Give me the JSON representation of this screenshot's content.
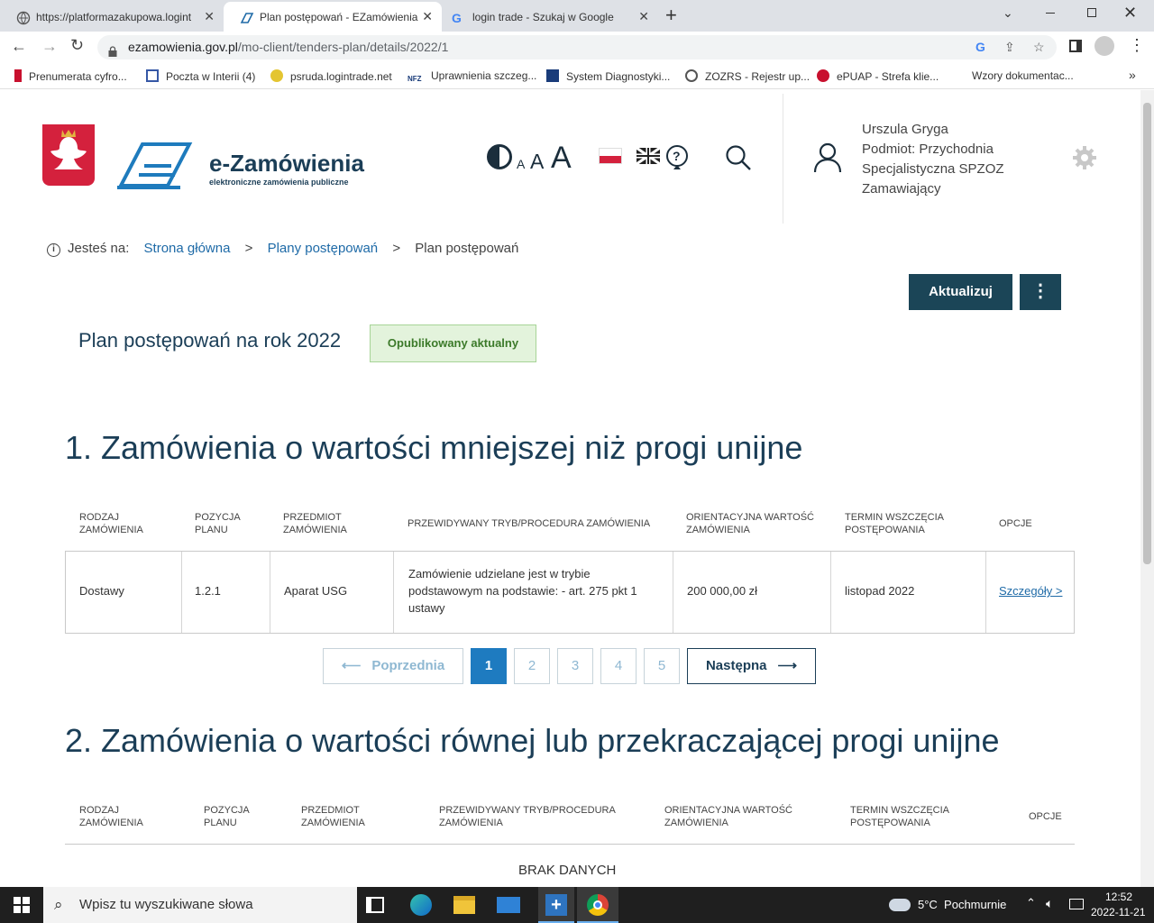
{
  "browser": {
    "tabs": [
      {
        "title": "https://platformazakupowa.logint"
      },
      {
        "title": "Plan postępowań - EZamówienia"
      },
      {
        "title": "login trade - Szukaj w Google"
      }
    ],
    "url_host": "ezamowienia.gov.pl",
    "url_path": "/mo-client/tenders-plan/details/2022/1",
    "bookmarks": [
      "Prenumerata cyfro...",
      "Poczta w Interii (4)",
      "psruda.logintrade.net",
      "Uprawnienia szczeg...",
      "System Diagnostyki...",
      "ZOZRS - Rejestr up...",
      "ePUAP - Strefa klie...",
      "Wzory dokumentac..."
    ]
  },
  "header": {
    "logo_title": "e-Zamówienia",
    "logo_subtitle": "elektroniczne zamówienia publiczne",
    "font_sizes": [
      "A",
      "A",
      "A"
    ],
    "user_name": "Urszula Gryga",
    "user_entity": "Podmiot: Przychodnia Specjalistyczna SPZOZ",
    "user_role": "Zamawiający"
  },
  "breadcrumb": {
    "prefix": "Jesteś na:",
    "items": [
      "Strona główna",
      "Plany postępowań",
      "Plan postępowań"
    ],
    "separator": ">"
  },
  "actions": {
    "update": "Aktualizuj"
  },
  "plan": {
    "title": "Plan postępowań na rok 2022",
    "status": "Opublikowany aktualny"
  },
  "section1": {
    "title": "1. Zamówienia o wartości mniejszej niż progi unijne",
    "headers": [
      "RODZAJ ZAMÓWIENIA",
      "POZYCJA PLANU",
      "PRZEDMIOT ZAMÓWIENIA",
      "PRZEWIDYWANY TRYB/PROCEDURA ZAMÓWIENIA",
      "ORIENTACYJNA WARTOŚĆ ZAMÓWIENIA",
      "TERMIN WSZCZĘCIA POSTĘPOWANIA",
      "OPCJE"
    ],
    "row": {
      "type": "Dostawy",
      "position": "1.2.1",
      "subject": "Aparat USG",
      "mode": "Zamówienie udzielane jest w trybie podstawowym na podstawie: - art. 275 pkt 1 ustawy",
      "value": "200 000,00 zł",
      "date": "listopad 2022",
      "details": "Szczegóły >"
    },
    "pagination": {
      "prev": "Poprzednia",
      "pages": [
        "1",
        "2",
        "3",
        "4",
        "5"
      ],
      "next": "Następna"
    }
  },
  "section2": {
    "title": "2. Zamówienia o wartości równej lub przekraczającej progi unijne",
    "headers": [
      "RODZAJ ZAMÓWIENIA",
      "POZYCJA PLANU",
      "PRZEDMIOT ZAMÓWIENIA",
      "PRZEWIDYWANY TRYB/PROCEDURA ZAMÓWIENIA",
      "ORIENTACYJNA WARTOŚĆ ZAMÓWIENIA",
      "TERMIN WSZCZĘCIA POSTĘPOWANIA",
      "OPCJE"
    ],
    "empty": "BRAK DANYCH"
  },
  "taskbar": {
    "search_placeholder": "Wpisz tu wyszukiwane słowa",
    "weather": "5°C  Pochmurnie",
    "time": "12:52",
    "date": "2022-11-21"
  },
  "colors": {
    "accent": "#1b4557",
    "link": "#1e6aa7",
    "status_bg": "#e3f3dc",
    "status_text": "#3c7a2a",
    "active_page": "#1e7bc0"
  }
}
